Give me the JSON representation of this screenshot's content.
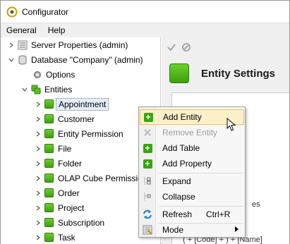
{
  "window": {
    "title": "Configurator"
  },
  "menu": {
    "items": [
      "General",
      "Help"
    ]
  },
  "tree": {
    "server_properties": "Server Properties (admin)",
    "database": "Database \"Company\" (admin)",
    "options": "Options",
    "entities": "Entities",
    "entity_items": [
      "Appointment",
      "Customer",
      "Entity Permission",
      "File",
      "Folder",
      "OLAP Cube Permission",
      "Order",
      "Project",
      "Subscription",
      "Task"
    ],
    "selected": "Appointment"
  },
  "right_panel": {
    "title": "Entity Settings",
    "partial_text": "es",
    "formula": "( + [Code] + ) + [Name]"
  },
  "context_menu": {
    "add_entity": "Add Entity",
    "remove_entity": "Remove Entity",
    "add_table": "Add Table",
    "add_property": "Add Property",
    "expand": "Expand",
    "collapse": "Collapse",
    "refresh": "Refresh",
    "refresh_shortcut": "Ctrl+R",
    "mode": "Mode"
  },
  "colors": {
    "accent_green": "#3fa010",
    "hover": "#fcf0c8",
    "refresh_blue": "#1f78c8"
  }
}
